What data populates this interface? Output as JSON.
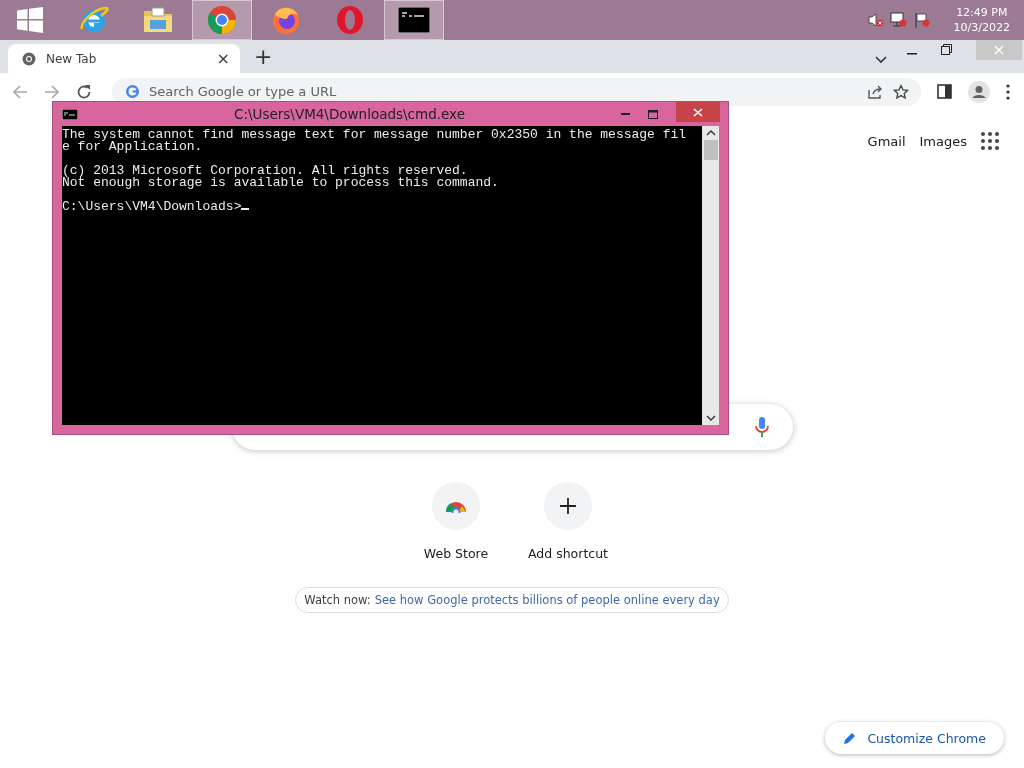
{
  "taskbar": {
    "apps": [
      {
        "kind": "windows",
        "selected": false
      },
      {
        "kind": "ie",
        "selected": false
      },
      {
        "kind": "explorer",
        "selected": false
      },
      {
        "kind": "chrome",
        "selected": true
      },
      {
        "kind": "firefox",
        "selected": false
      },
      {
        "kind": "opera",
        "selected": false
      },
      {
        "kind": "cmd",
        "selected": true
      }
    ],
    "tray": {
      "time": "12:49 PM",
      "date": "10/3/2022"
    }
  },
  "browser": {
    "tabs": [
      {
        "title": "New Tab",
        "close": "×",
        "selected": true
      }
    ],
    "new_tab": "+",
    "omnibox": {
      "placeholder": "Search Google or type a URL"
    }
  },
  "page": {
    "links": [
      "Gmail",
      "Images"
    ],
    "shortcuts": [
      {
        "kind": "webstore",
        "label": "Web Store"
      },
      {
        "kind": "add",
        "label": "Add shortcut"
      }
    ],
    "promo": {
      "lead": "Watch now:",
      "link": "See how Google protects billions of people online every day"
    },
    "customize": "Customize Chrome"
  },
  "console": {
    "title": "C:\\Users\\VM4\\Downloads\\cmd.exe",
    "blocks": [
      [
        "The system cannot find message text for message number 0x2350 in the message fil",
        "e for Application."
      ],
      [
        "(c) 2013 Microsoft Corporation. All rights reserved.",
        "Not enough storage is available to process this command."
      ],
      [
        "C:\\Users\\VM4\\Downloads>"
      ]
    ]
  }
}
